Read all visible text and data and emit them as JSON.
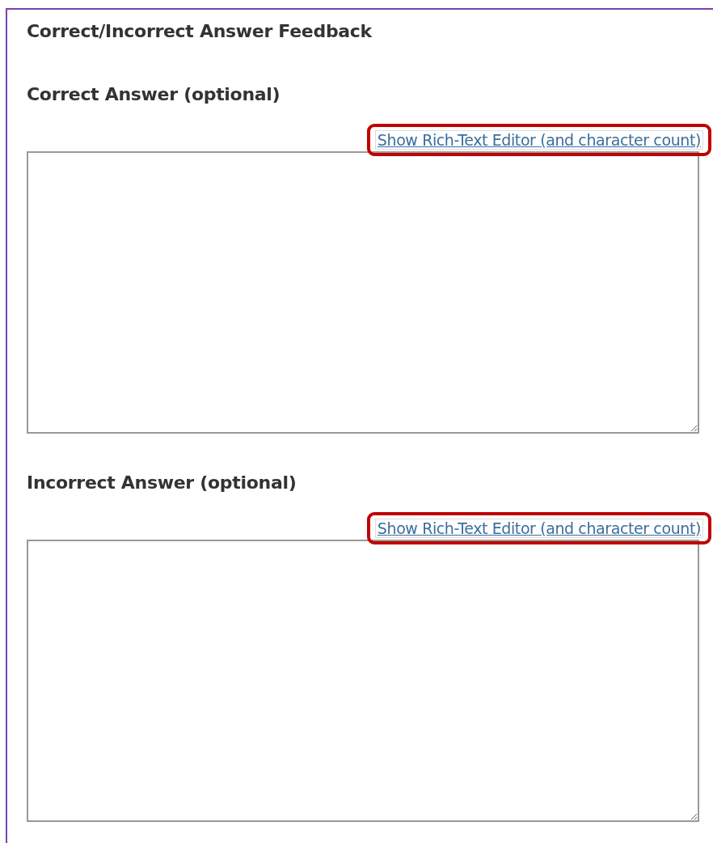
{
  "section": {
    "title": "Correct/Incorrect Answer Feedback"
  },
  "fields": [
    {
      "label": "Correct Answer (optional)",
      "link": "Show Rich-Text Editor (and character count)",
      "highlighted": true
    },
    {
      "label": "Incorrect Answer (optional)",
      "link": "Show Rich-Text Editor (and character count)",
      "highlighted": true
    }
  ]
}
